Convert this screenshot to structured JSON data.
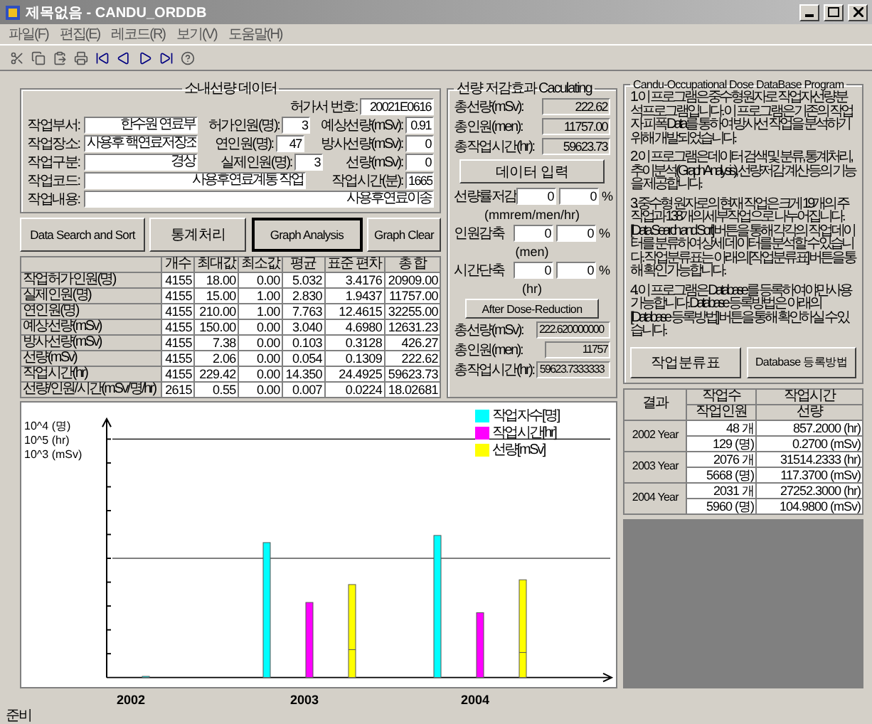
{
  "window": {
    "title": "제목없음 - CANDU_ORDDB"
  },
  "menu": [
    "파일(F)",
    "편집(E)",
    "레코드(R)",
    "보기(V)",
    "도움말(H)"
  ],
  "record": {
    "title": "소내선량 데이터",
    "permit_label": "허가서 번호:",
    "permit_value": "20021E0616",
    "rows": [
      {
        "fields": [
          {
            "label": "작업부서:",
            "value": "한수원 연료부",
            "kind": "wide"
          },
          {
            "label": "허가인원(명):",
            "value": "3",
            "kind": "small"
          },
          {
            "label": "예상선량(mSv):",
            "value": "0.91",
            "kind": "small"
          }
        ]
      },
      {
        "fields": [
          {
            "label": "작업장소:",
            "value": "사용후 핵연료저장조",
            "kind": "wide"
          },
          {
            "label": "연인원(명):",
            "value": "47",
            "kind": "small"
          },
          {
            "label": "방사선량(mSv):",
            "value": "0",
            "kind": "small"
          }
        ]
      },
      {
        "fields": [
          {
            "label": "작업구분:",
            "value": "경상",
            "kind": "wide"
          },
          {
            "label": "실제인원(명):",
            "value": "3",
            "kind": "small"
          },
          {
            "label": "선량(mSv):",
            "value": "0",
            "kind": "small"
          }
        ]
      },
      {
        "fields": [
          {
            "label": "작업코드:",
            "value": "사용후연료계통 작업",
            "kind": "long"
          },
          {
            "label": "작업시간(분):",
            "value": "1665",
            "kind": "small"
          }
        ]
      },
      {
        "fields": [
          {
            "label": "작업내용:",
            "value": "사용후연료이송",
            "kind": "full"
          }
        ]
      }
    ]
  },
  "actions": [
    {
      "label": "Data Search and Sort",
      "selected": false
    },
    {
      "label": "통계처리",
      "selected": false
    },
    {
      "label": "Graph Analysis",
      "selected": true
    },
    {
      "label": "Graph Clear",
      "selected": false
    }
  ],
  "stats": {
    "columns": [
      "",
      "개수",
      "최대값",
      "최소값",
      "평균",
      "표준 편차",
      "총 합"
    ],
    "rows": [
      [
        "작업허가인원(명)",
        "4155",
        "18.00",
        "0.00",
        "5.032",
        "3.4176",
        "20909.00"
      ],
      [
        "실제인원(명)",
        "4155",
        "15.00",
        "1.00",
        "2.830",
        "1.9437",
        "11757.00"
      ],
      [
        "연인원(명)",
        "4155",
        "210.00",
        "1.00",
        "7.763",
        "12.4615",
        "32255.00"
      ],
      [
        "예상선량(mSv)",
        "4155",
        "150.00",
        "0.00",
        "3.040",
        "4.6980",
        "12631.23"
      ],
      [
        "방사선량(mSv)",
        "4155",
        "7.38",
        "0.00",
        "0.103",
        "0.3128",
        "426.27"
      ],
      [
        "선량(mSv)",
        "4155",
        "2.06",
        "0.00",
        "0.054",
        "0.1309",
        "222.62"
      ],
      [
        "작업시간(hr)",
        "4155",
        "229.42",
        "0.00",
        "14.350",
        "24.4925",
        "59623.73"
      ],
      [
        "선량/인원/시간(mSv/명/hr)",
        "2615",
        "0.55",
        "0.00",
        "0.007",
        "0.0224",
        "18.02681"
      ]
    ]
  },
  "calc": {
    "title": "선량 저감효과 Caculating",
    "totals": [
      {
        "label": "총선량(mSv):",
        "value": "222.62"
      },
      {
        "label": "총인원(men):",
        "value": "11757.00"
      },
      {
        "label": "총작업시간(hr):",
        "value": "59623.73"
      }
    ],
    "input_button": "데이터 입력",
    "reductions": [
      {
        "label": "선량률저감:",
        "value": "0",
        "percent": "0",
        "unit_sign": "%",
        "unit": "(mmrem/men/hr)"
      },
      {
        "label": "인원감축",
        "value": "0",
        "percent": "0",
        "unit_sign": "%",
        "unit": "(men)"
      },
      {
        "label": "시간단축",
        "value": "0",
        "percent": "0",
        "unit_sign": "%",
        "unit": "(hr)"
      }
    ],
    "after_button": "After Dose-Reduction",
    "results": [
      {
        "label": "총선량(mSv):",
        "value": "222.620000000"
      },
      {
        "label": "총인원(men):",
        "value": "11757"
      },
      {
        "label": "총작업시간(hr):",
        "value": "59623.7333333"
      }
    ]
  },
  "info": {
    "title": "Candu-Occupational Dose DataBase Program",
    "paragraphs": [
      "1. 이 프로그램은 중수형원자로 작업자선량 분석프로그램입니다. 이 프로그램은 기존의 작업자 피폭 Data를 통하여 방사선 작업을 분석하기 위해 개발되었습니다.",
      "2. 이 프로그램은 데이터 검색 및 분류, 통계처리, 추이분석(Graph Analysis), 선량저감 계산 등의 기능을 제공합니다.",
      "3. 중수형 원자로의 현재 작업은 크게 19개의 주작업과 138개의 세부작업으로 나누어집니다. [Data Search and Sort] 버튼을 통해 각각의 작업 데이터를 분류하여 상세 데이터를 분석할 수 있습니다. 작업분류표는 아래의 [작업분류표] 버튼을 통해 확인 가능합니다.",
      "4. 이 프로그램은 Database를 등록하여야만 사용 가능합니다. Database 등록방법은 아래의 [Database 등록방법] 버튼을 통해 확인하실 수 있습니다."
    ],
    "buttons": [
      "작업분류표",
      "Database 등록방법"
    ]
  },
  "graph": {
    "y_labels": [
      "10^4 (명)",
      "10^5 (hr)",
      "10^3 (mSv)"
    ],
    "legend": [
      {
        "label": "작업자수[명]",
        "color": "#00ffff"
      },
      {
        "label": "작업시간[hr]",
        "color": "#ff00ff"
      },
      {
        "label": "선량[mSv]",
        "color": "#ffff00"
      }
    ],
    "years": [
      "2002",
      "2003",
      "2004"
    ]
  },
  "result": {
    "header": "결과",
    "count_header": "작업수",
    "people_header": "작업인원",
    "hours_header": "작업시간",
    "dose_header": "선량",
    "rows": [
      {
        "year": "2002 Year",
        "count": "48 개",
        "people": "129 (명)",
        "hours": "857.2000 (hr)",
        "dose": "0.2700 (mSv)"
      },
      {
        "year": "2003 Year",
        "count": "2076 개",
        "people": "5668 (명)",
        "hours": "31514.2333 (hr)",
        "dose": "117.3700 (mSv)"
      },
      {
        "year": "2004 Year",
        "count": "2031 개",
        "people": "5960 (명)",
        "hours": "27252.3000 (hr)",
        "dose": "104.9800 (mSv)"
      }
    ]
  },
  "status": "준비"
}
